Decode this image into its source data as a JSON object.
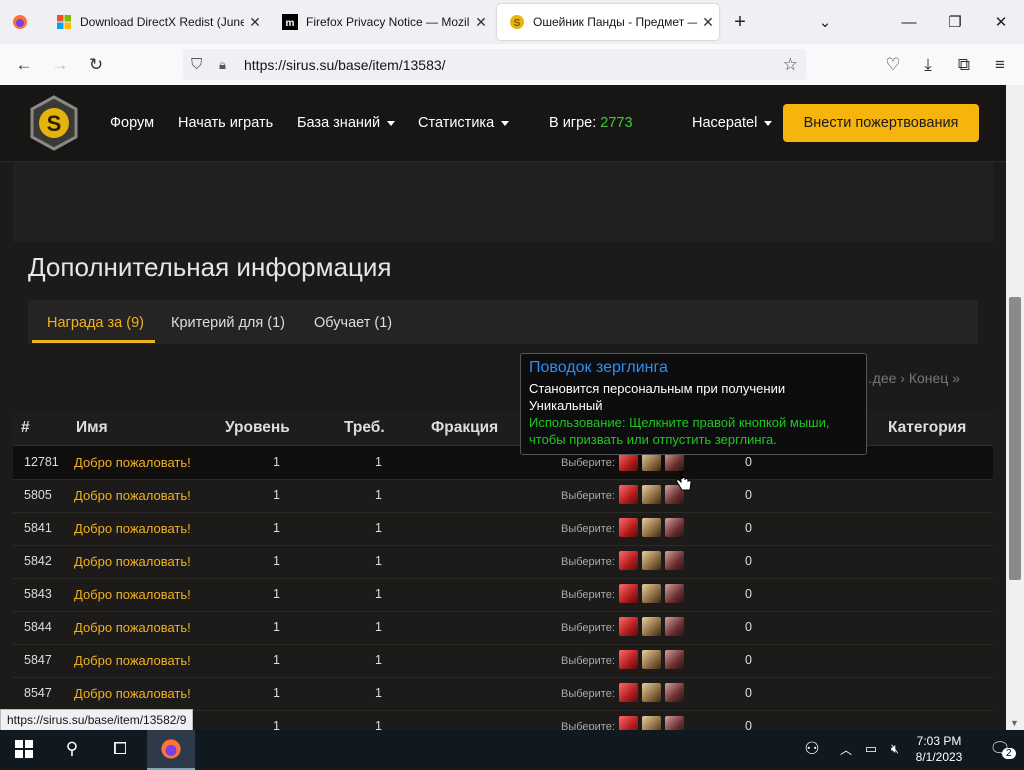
{
  "browser": {
    "tabs": [
      {
        "title": "Download DirectX Redist (June",
        "favicon": "windows-logo-icon"
      },
      {
        "title": "Firefox Privacy Notice — Mozill",
        "favicon": "mozilla-m-icon"
      },
      {
        "title": "Ошейник Панды - Предмет —",
        "favicon": "sirus-coin-icon"
      }
    ],
    "new_tab": "+",
    "url": "https://sirus.su/base/item/13583/",
    "status_url": "https://sirus.su/base/item/13582/9"
  },
  "site": {
    "nav": [
      {
        "label": "Форум"
      },
      {
        "label": "Начать играть"
      },
      {
        "label": "База знаний"
      },
      {
        "label": "Статистика"
      }
    ],
    "online_label": "В игре:",
    "online_count": "2773",
    "online_color": "#3ec63e",
    "user": "Hacepatel",
    "donate": "Внести пожертвования",
    "accent_color": "#f5b50c"
  },
  "section": {
    "title": "Дополнительная информация",
    "tabs": [
      {
        "label": "Награда за (9)"
      },
      {
        "label": "Критерий для (1)"
      },
      {
        "label": "Обучает (1)"
      }
    ],
    "pager": "…дее ›   Конец »"
  },
  "table": {
    "headers": {
      "id": "#",
      "name": "Имя",
      "level": "Уровень",
      "req": "Треб.",
      "faction": "Фракция",
      "category": "Категория"
    },
    "rows": [
      {
        "id": "12781",
        "name": "Добро пожаловать!",
        "level": "1",
        "req": "1",
        "pick": "Выберите:",
        "value": "0"
      },
      {
        "id": "5805",
        "name": "Добро пожаловать!",
        "level": "1",
        "req": "1",
        "pick": "Выберите:",
        "value": "0"
      },
      {
        "id": "5841",
        "name": "Добро пожаловать!",
        "level": "1",
        "req": "1",
        "pick": "Выберите:",
        "value": "0"
      },
      {
        "id": "5842",
        "name": "Добро пожаловать!",
        "level": "1",
        "req": "1",
        "pick": "Выберите:",
        "value": "0"
      },
      {
        "id": "5843",
        "name": "Добро пожаловать!",
        "level": "1",
        "req": "1",
        "pick": "Выберите:",
        "value": "0"
      },
      {
        "id": "5844",
        "name": "Добро пожаловать!",
        "level": "1",
        "req": "1",
        "pick": "Выберите:",
        "value": "0"
      },
      {
        "id": "5847",
        "name": "Добро пожаловать!",
        "level": "1",
        "req": "1",
        "pick": "Выберите:",
        "value": "0"
      },
      {
        "id": "8547",
        "name": "Добро пожаловать!",
        "level": "1",
        "req": "1",
        "pick": "Выберите:",
        "value": "0"
      },
      {
        "id": "",
        "name": "",
        "level": "1",
        "req": "1",
        "pick": "Выберите:",
        "value": "0"
      }
    ]
  },
  "tooltip": {
    "title": "Поводок зерглинга",
    "line1": "Становится персональным при получении",
    "line2": "Уникальный",
    "use1": "Использование: Щелкните правой кнопкой мыши,",
    "use2": "чтобы призвать или отпустить зерглинга."
  },
  "taskbar": {
    "time": "7:03 PM",
    "date": "8/1/2023",
    "notifications": "2"
  }
}
